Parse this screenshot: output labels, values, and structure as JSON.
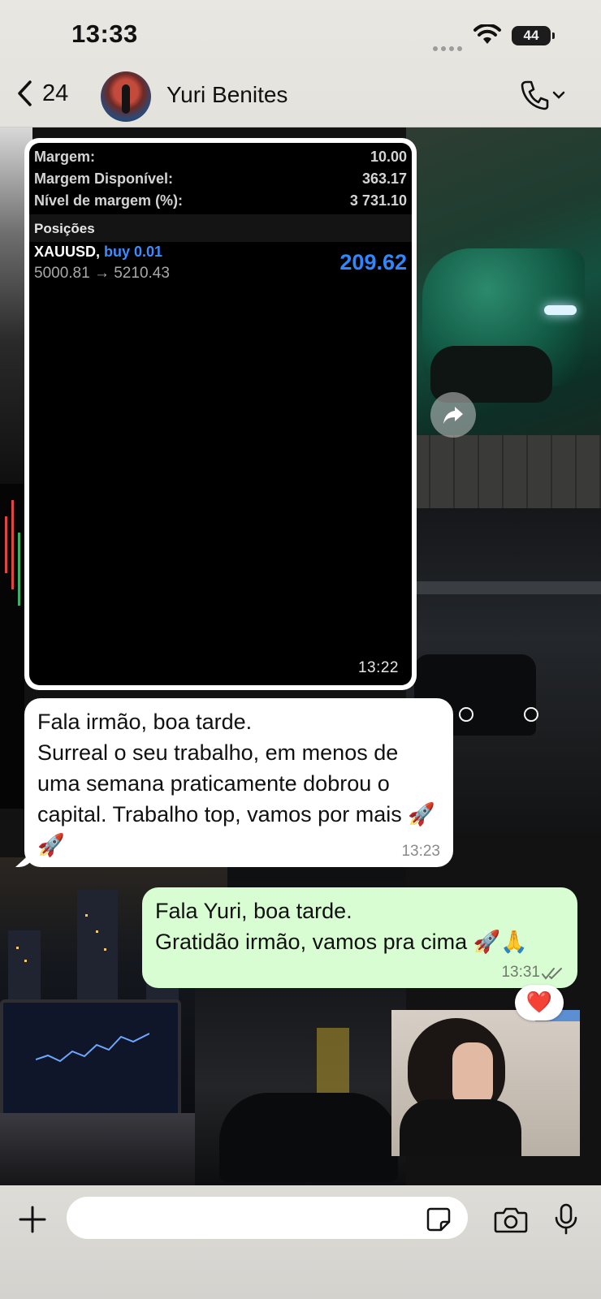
{
  "status_bar": {
    "time": "13:33",
    "battery": "44"
  },
  "header": {
    "back_count": "24",
    "contact_name": "Yuri Benites"
  },
  "image_message": {
    "account": [
      {
        "label": "Margem:",
        "value": "10.00"
      },
      {
        "label": "Margem Disponível:",
        "value": "363.17"
      },
      {
        "label": "Nível de margem (%):",
        "value": "3 731.10"
      }
    ],
    "positions_title": "Posições",
    "position": {
      "symbol": "XAUUSD,",
      "side": "buy 0.01",
      "prices": "5000.81 → 5210.43",
      "profit": "209.62"
    },
    "time": "13:22"
  },
  "incoming_message": {
    "text": "Fala irmão, boa tarde.\nSurreal o seu trabalho, em menos de uma semana praticamente dobrou o capital. Trabalho top, vamos por mais 🚀 🚀",
    "time": "13:23"
  },
  "outgoing_message": {
    "text": "Fala Yuri, boa tarde.\nGratidão irmão, vamos pra cima 🚀🙏",
    "time": "13:31"
  },
  "reaction": {
    "emoji": "❤️"
  },
  "icons": {
    "back": "chevron-left-icon",
    "call": "phone-icon",
    "forward": "forward-icon",
    "plus": "plus-icon",
    "sticker": "sticker-icon",
    "camera": "camera-icon",
    "mic": "microphone-icon"
  },
  "colors": {
    "outgoing_bubble": "#d9fdd3",
    "incoming_bubble": "#ffffff",
    "profit_blue": "#2f87ff",
    "read_ticks": "#6f7a6b"
  }
}
